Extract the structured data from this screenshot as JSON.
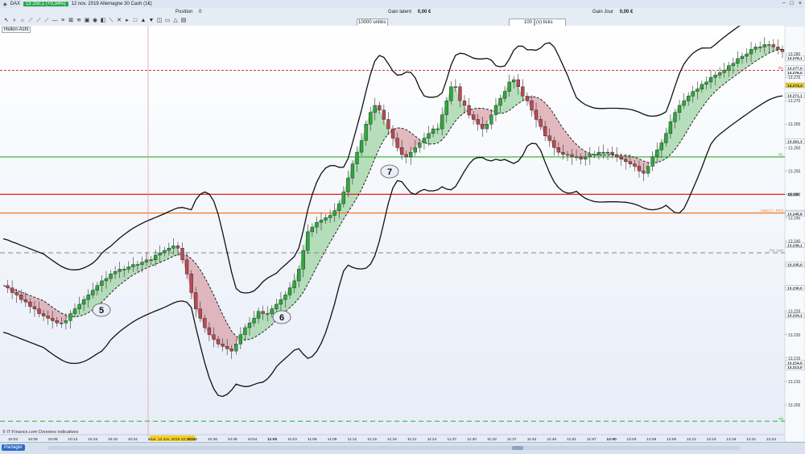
{
  "titlebar": {
    "instrument": "DAX",
    "price": "13 250,1 (+0,34%)",
    "title": "12 nov. 2019 Allemagne 30 Cash (1€)",
    "controls": [
      "−",
      "□",
      "×"
    ]
  },
  "toolbar": {
    "position_label": "Position",
    "position_value": "0",
    "gain_latent_label": "Gain latent",
    "gain_latent_value": "0,00 €",
    "gain_jour_label": "Gain Jour",
    "gain_jour_value": "0,00 €",
    "quantity": "10000 unités",
    "ticks_value": "100",
    "ticks_unit": "(x) ticks",
    "indicator_tab": "Heikin-Ashi"
  },
  "chart_data": {
    "type": "candlestick",
    "title": "",
    "xlabel": "",
    "ylabel": "",
    "ylim": [
      13200,
      13285
    ],
    "x_ticks": [
      "10:03",
      "10:06",
      "10:09",
      "10:12",
      "10:15",
      "10:18",
      "10:24",
      "10:27",
      "mar. 12 nov. 2019 10:35:42",
      "10:42",
      "10:45",
      "10:48",
      "10:54",
      "11:00",
      "11:03",
      "11:06",
      "11:09",
      "11:12",
      "11:15",
      "11:18",
      "11:21",
      "11:24",
      "11:27",
      "11:30",
      "11:33",
      "11:37",
      "11:42",
      "11:46",
      "11:51",
      "11:57",
      "12:00",
      "12:03",
      "12:06",
      "12:09",
      "12:12",
      "12:15",
      "12:18",
      "12:21",
      "12:24"
    ],
    "y_ticks": [
      "13.280",
      "13.275",
      "13.270",
      "13.265",
      "13.260",
      "13.255",
      "13.250",
      "13.245",
      "13.240",
      "13.235",
      "13.230",
      "13.225",
      "13.220",
      "13.215",
      "13.210",
      "13.205"
    ],
    "price_boxes": [
      {
        "text": "13.279,1",
        "color": "#ffffff",
        "value": 13279.1
      },
      {
        "text": "13.277,0",
        "color": "#ffffff",
        "value": 13277.0
      },
      {
        "text": "13.276,0",
        "color": "#ffffff",
        "value": 13276.0
      },
      {
        "text": "13.273,3",
        "color": "#f4d21c",
        "value": 13273.3
      },
      {
        "text": "13.271,1",
        "color": "#ffffff",
        "value": 13271.1
      },
      {
        "text": "13.261,3",
        "color": "#ffffff",
        "value": 13261.3
      },
      {
        "text": "13.250",
        "color": "none",
        "value": 13250.0
      },
      {
        "text": "13.246,1",
        "color": "#ffffff",
        "value": 13246.1
      },
      {
        "text": "13.245,8",
        "color": "#ffffff",
        "value": 13245.8
      },
      {
        "text": "13.239,1",
        "color": "#ffffff",
        "value": 13239.1
      },
      {
        "text": "13.235,0",
        "color": "#ffffff",
        "value": 13235.0
      },
      {
        "text": "13.230,0",
        "color": "#ffffff",
        "value": 13230.0
      },
      {
        "text": "13.224,1",
        "color": "#ffffff",
        "value": 13224.1
      },
      {
        "text": "13.214,0",
        "color": "#ffffff",
        "value": 13214.0
      },
      {
        "text": "13.213,0",
        "color": "#ffffff",
        "value": 13213.0
      }
    ],
    "levels": [
      {
        "name": "R1",
        "value": 13276.5,
        "color": "#e03030",
        "style": "dotted"
      },
      {
        "name": "R1",
        "value": 13258.0,
        "color": "#2bb02b",
        "style": "solid"
      },
      {
        "name": "",
        "value": 13250.0,
        "color": "#e02020",
        "style": "solid"
      },
      {
        "name": "Haut (J - Prix)",
        "value": 13246.0,
        "color": "#f07820",
        "style": "solid"
      },
      {
        "name": "Piv. Jour",
        "value": 13237.5,
        "color": "#888888",
        "style": "dashed"
      },
      {
        "name": "Pb",
        "value": 13201.5,
        "color": "#2bb02b",
        "style": "dashed"
      }
    ],
    "annotations": [
      "5",
      "6",
      "7"
    ],
    "series": [
      {
        "values": [
          13230.5,
          13230,
          13229,
          13228.5,
          13227.5,
          13227,
          13226,
          13225.5,
          13224.5,
          13224,
          13223.5,
          13223,
          13222.5,
          13222.5,
          13223,
          13224.5,
          13225.5,
          13226.5,
          13227.5,
          13228.5,
          13229.5,
          13230.5,
          13231.5,
          13232,
          13233,
          13233.5,
          13234,
          13234,
          13234.5,
          13235,
          13235,
          13235.5,
          13236,
          13236,
          13237,
          13237.5,
          13238,
          13238.5,
          13239,
          13238.5,
          13236,
          13233,
          13229,
          13225.5,
          13223.5,
          13221.5,
          13220,
          13219,
          13218,
          13217.5,
          13217,
          13216.5,
          13218,
          13220,
          13221.5,
          13222.5,
          13223.5,
          13225,
          13224.5,
          13224.5,
          13225.5,
          13226.5,
          13227.5,
          13228.5,
          13230,
          13231.5,
          13234,
          13238,
          13242,
          13243,
          13244,
          13244.5,
          13245,
          13245.5,
          13246.5,
          13248,
          13250.5,
          13253.5,
          13256.5,
          13259,
          13261.5,
          13265,
          13267.5,
          13269,
          13268,
          13266,
          13264,
          13262,
          13260,
          13258.5,
          13258,
          13259,
          13260,
          13261,
          13262,
          13263,
          13264,
          13264,
          13267,
          13270,
          13273,
          13273,
          13270,
          13269,
          13267,
          13266,
          13265,
          13264,
          13265,
          13267,
          13269,
          13270.5,
          13272,
          13274,
          13274.5,
          13273,
          13271,
          13270,
          13268,
          13266,
          13264.5,
          13262.5,
          13261.5,
          13260,
          13259,
          13258.5,
          13258.5,
          13258,
          13258,
          13257.5,
          13258,
          13258.5,
          13258.5,
          13259,
          13259,
          13259,
          13258.5,
          13258,
          13257.5,
          13257,
          13256.5,
          13256,
          13255,
          13254.5,
          13256,
          13258,
          13259.5,
          13261,
          13263,
          13265.5,
          13267.5,
          13269,
          13270,
          13271,
          13272,
          13272.5,
          13273.5,
          13274,
          13275,
          13275.5,
          13276,
          13276.5,
          13277.5,
          13278,
          13279,
          13279.5,
          13280,
          13281,
          13281.5,
          13281.5,
          13282,
          13282,
          13281.5,
          13281,
          13280.5
        ]
      }
    ]
  },
  "footer": {
    "note": "© IT-Finance.com Données indicatives"
  },
  "statusbar": {
    "share_label": "Partager",
    "icons": [
      "grid-icon",
      "list-icon",
      "settings-icon",
      "arrow-left-icon",
      "arrow-right-icon",
      "zoom-out-icon",
      "zoom-in-icon",
      "zoom-reset-icon"
    ]
  }
}
